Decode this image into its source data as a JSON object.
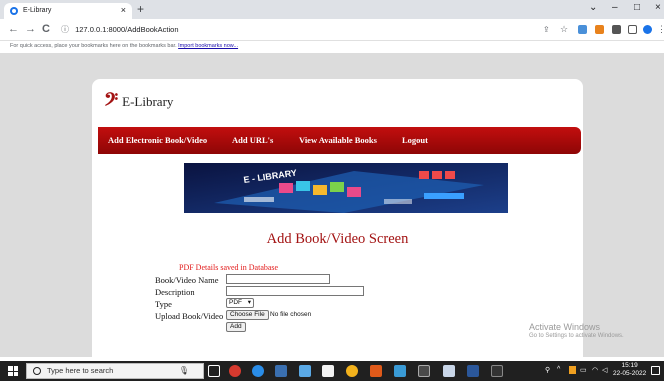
{
  "browser": {
    "tab_title": "E-Library",
    "tab_close": "×",
    "new_tab": "+",
    "url": "127.0.0.1:8000/AddBookAction",
    "back": "←",
    "forward": "→",
    "reload": "C",
    "info_icon": "ⓘ",
    "window_minimize": "–",
    "window_maximize": "□",
    "window_close": "×",
    "bookmarks_text": "For quick access, place your bookmarks here on the bookmarks bar.",
    "bookmarks_link": "Import bookmarks now..."
  },
  "site": {
    "logo_icon": "𝄢",
    "logo_text": "E-Library",
    "menu": [
      {
        "label": "Add Electronic Book/Video"
      },
      {
        "label": "Add URL's"
      },
      {
        "label": "View Available Books"
      },
      {
        "label": "Logout"
      }
    ],
    "banner_text": "E - LIBRARY",
    "heading": "Add Book/Video Screen",
    "message": "PDF Details saved in Database",
    "form": {
      "name_label": "Book/Video Name",
      "description_label": "Description",
      "type_label": "Type",
      "type_value": "PDF",
      "upload_label": "Upload Book/Video",
      "choose_file": "Choose File",
      "no_file": "No file chosen",
      "add_button": "Add"
    },
    "accent_color": "#a31313"
  },
  "watermark": {
    "line1": "Activate Windows",
    "line2": "Go to Settings to activate Windows."
  },
  "taskbar": {
    "search_placeholder": "Type here to search",
    "time": "15:19",
    "date": "22-05-2022"
  }
}
